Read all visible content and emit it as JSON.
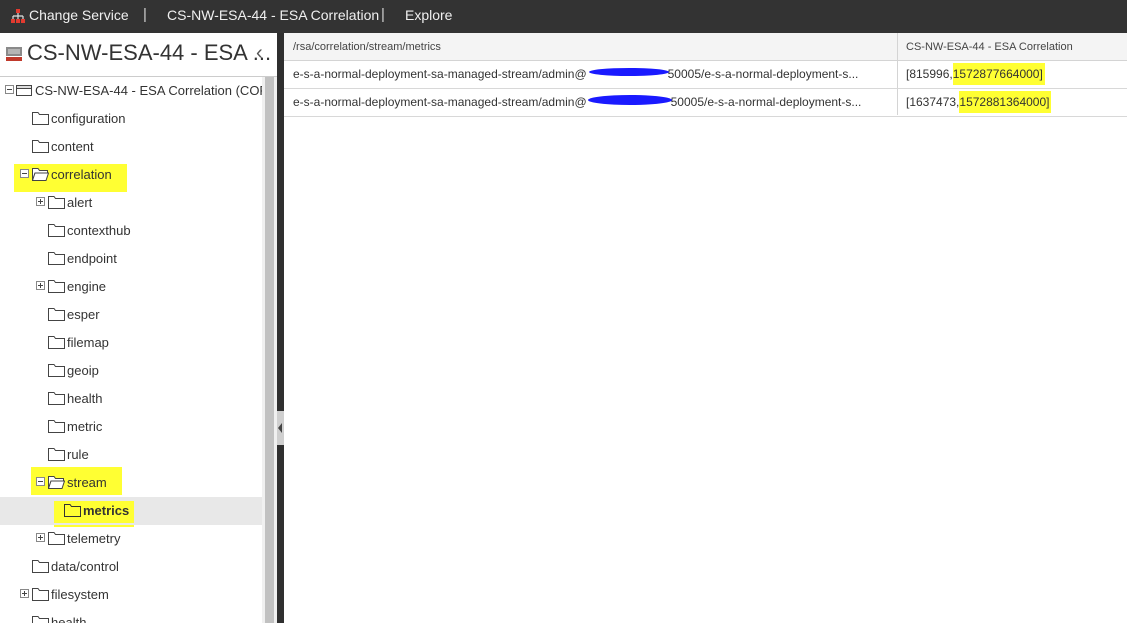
{
  "topbar": {
    "change_service": "Change Service",
    "service_name": "CS-NW-ESA-44 - ESA Correlation",
    "explore": "Explore",
    "separator": "|"
  },
  "left_panel": {
    "title": "CS-NW-ESA-44 - ESA ...",
    "collapse_glyph": "‹",
    "tree": {
      "root": "CS-NW-ESA-44 - ESA Correlation (CORR...",
      "configuration": "configuration",
      "content": "content",
      "correlation": "correlation",
      "alert": "alert",
      "contexthub": "contexthub",
      "endpoint": "endpoint",
      "engine": "engine",
      "esper": "esper",
      "filemap": "filemap",
      "geoip": "geoip",
      "health": "health",
      "metric": "metric",
      "rule": "rule",
      "stream": "stream",
      "metrics": "metrics",
      "telemetry": "telemetry",
      "data_control": "data/control",
      "filesystem": "filesystem",
      "health2": "health"
    }
  },
  "grid": {
    "headers": [
      "/rsa/correlation/stream/metrics",
      "CS-NW-ESA-44 - ESA Correlation"
    ],
    "rows": [
      {
        "path_prefix": "e-s-a-normal-deployment-sa-managed-stream/admin@",
        "path_suffix": "50005/e-s-a-normal-deployment-s...",
        "value_prefix": "[815996,",
        "value_ts": "1572877664000]"
      },
      {
        "path_prefix": "e-s-a-normal-deployment-sa-managed-stream/admin@",
        "path_suffix": "50005/e-s-a-normal-deployment-s...",
        "value_prefix": "[1637473,",
        "value_ts": "1572881364000]"
      }
    ]
  },
  "colors": {
    "topbar_bg": "#333333",
    "highlight": "#ffff33",
    "redaction": "#1a1aff",
    "selected_row": "#e8e8e8"
  }
}
